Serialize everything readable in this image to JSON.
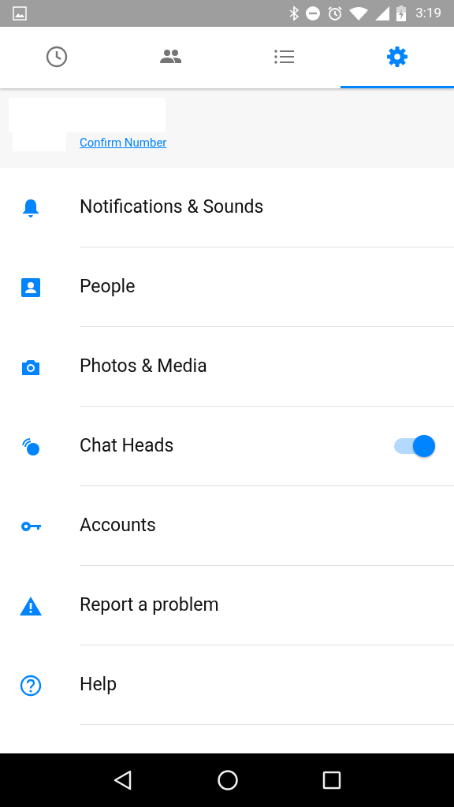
{
  "status_bar": {
    "time": "3:19"
  },
  "tabs": [
    {
      "selected": false
    },
    {
      "selected": false
    },
    {
      "selected": false
    },
    {
      "selected": true
    }
  ],
  "profile": {
    "link": "Confirm Number"
  },
  "settings": [
    {
      "label": "Notifications & Sounds",
      "kind": "plain"
    },
    {
      "label": "People",
      "kind": "plain"
    },
    {
      "label": "Photos & Media",
      "kind": "plain"
    },
    {
      "label": "Chat Heads",
      "kind": "toggle",
      "on": true
    },
    {
      "label": "Accounts",
      "kind": "plain"
    },
    {
      "label": "Report a problem",
      "kind": "plain"
    },
    {
      "label": "Help",
      "kind": "plain"
    }
  ]
}
